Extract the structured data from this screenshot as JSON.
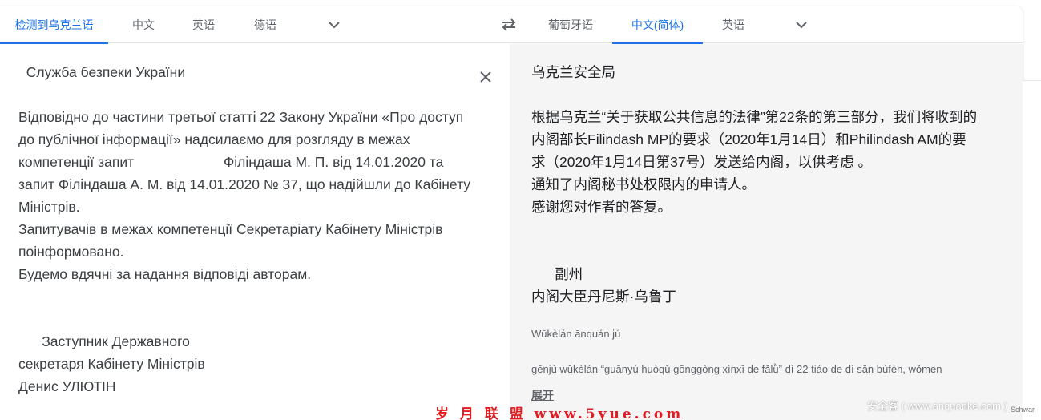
{
  "source_tabs": [
    {
      "label": "检测到乌克兰语",
      "active": true
    },
    {
      "label": "中文",
      "active": false
    },
    {
      "label": "英语",
      "active": false
    },
    {
      "label": "德语",
      "active": false
    }
  ],
  "target_tabs": [
    {
      "label": "葡萄牙语",
      "active": false
    },
    {
      "label": "中文(简体)",
      "active": true
    },
    {
      "label": "英语",
      "active": false
    }
  ],
  "icons": {
    "swap": "swap-arrows-icon",
    "source_dropdown": "chevron-down-icon",
    "target_dropdown": "chevron-down-icon",
    "clear": "close-icon"
  },
  "colors": {
    "accent": "#1a73e8",
    "target_bg": "#f5f5f5",
    "watermark_red": "#e31b23"
  },
  "source_text": "  Служба безпеки України\n\nВідповідно до частини третьої статті 22 Закону України «Про доступ до публічної інформації» надсилаємо для розгляду в межах компетенції запит                       Філіндаша М. П. від 14.01.2020 та запит Філіндаша А. М. від 14.01.2020 № 37, що надійшли до Кабінету Міністрів.\nЗапитувачів в межах компетенції Секретаріату Кабінету Міністрів поінформовано.\nБудемо вдячні за надання відповіді авторам.\n\n\n      Заступник Державного\nсекретаря Кабінету Міністрів\nДенис УЛЮТІН",
  "translation_text": "乌克兰安全局\n\n根据乌克兰“关于获取公共信息的法律”第22条的第三部分，我们将收到的内阁部长Filindash MP的要求（2020年1月14日）和Philindash AM的要求（2020年1月14日第37号）发送给内阁，以供考虑 。\n通知了内阁秘书处权限内的申请人。\n感谢您对作者的答复。\n\n\n      副州\n内阁大臣丹尼斯·乌鲁丁",
  "transliteration": {
    "line1": "Wūkèlán ānquán jú",
    "line2": "gēnjù wūkèlán “guānyú huòqǔ gōnggòng xìnxī de fǎlǜ” dì 22 tiáo de dì sān bùfèn, wǒmen"
  },
  "expand_label": "展开",
  "watermarks": {
    "left": "岁 月 联 盟   www.5yue.com",
    "right": "安全客 ( www.anquanke.com )",
    "tiny": "Schwar"
  }
}
